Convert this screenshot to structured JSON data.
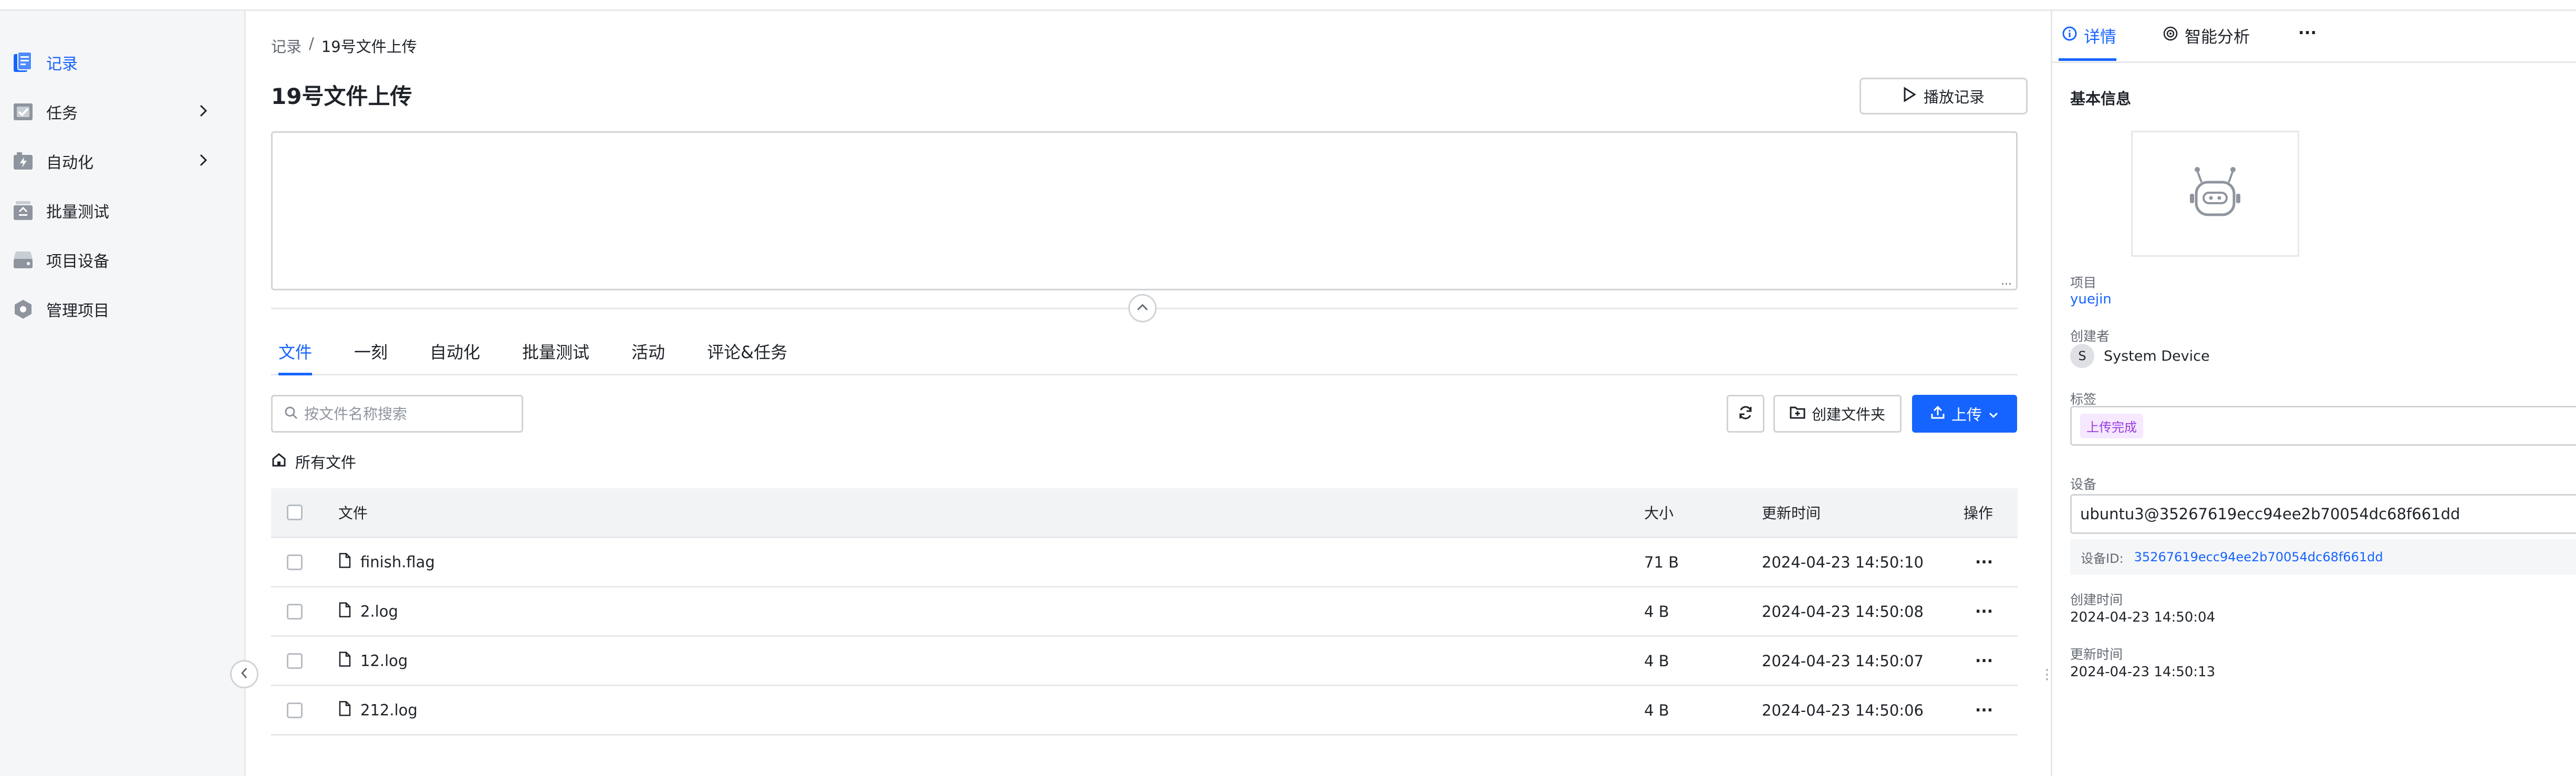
{
  "sidebar": {
    "items": [
      {
        "label": "记录",
        "icon": "record-icon",
        "active": true
      },
      {
        "label": "任务",
        "icon": "task-icon",
        "has_children": true
      },
      {
        "label": "自动化",
        "icon": "automation-icon",
        "has_children": true
      },
      {
        "label": "批量测试",
        "icon": "batch-test-icon"
      },
      {
        "label": "项目设备",
        "icon": "device-icon"
      },
      {
        "label": "管理项目",
        "icon": "manage-project-icon"
      }
    ]
  },
  "breadcrumb": {
    "root": "记录",
    "separator": "/",
    "current": "19号文件上传"
  },
  "page": {
    "title": "19号文件上传",
    "play_button": "播放记录",
    "textarea_resize": "..."
  },
  "tabs": [
    "文件",
    "一刻",
    "自动化",
    "批量测试",
    "活动",
    "评论&任务"
  ],
  "files": {
    "search_placeholder": "按文件名称搜索",
    "new_folder_button": "创建文件夹",
    "upload_button": "上传",
    "all_files_label": "所有文件",
    "columns": {
      "name": "文件",
      "size": "大小",
      "updated": "更新时间",
      "actions": "操作"
    },
    "rows": [
      {
        "name": "finish.flag",
        "size": "71 B",
        "updated": "2024-04-23 14:50:10",
        "actions": "···"
      },
      {
        "name": "2.log",
        "size": "4 B",
        "updated": "2024-04-23 14:50:08",
        "actions": "···"
      },
      {
        "name": "12.log",
        "size": "4 B",
        "updated": "2024-04-23 14:50:07",
        "actions": "···"
      },
      {
        "name": "212.log",
        "size": "4 B",
        "updated": "2024-04-23 14:50:06",
        "actions": "···"
      }
    ]
  },
  "right_panel": {
    "tabs": {
      "details": "详情",
      "analysis": "智能分析",
      "more": "···"
    },
    "section_title": "基本信息",
    "project_label": "项目",
    "project_value": "yuejin",
    "creator_label": "创建者",
    "creator_initial": "S",
    "creator_name": "System Device",
    "tag_label": "标签",
    "tag_value": "上传完成",
    "device_label": "设备",
    "device_value": "ubuntu3@35267619ecc94ee2b70054dc68f661dd",
    "device_id_label": "设备ID:",
    "device_id_value": "35267619ecc94ee2b70054dc68f661dd",
    "created_label": "创建时间",
    "created_value": "2024-04-23 14:50:04",
    "updated_label": "更新时间",
    "updated_value": "2024-04-23 14:50:13"
  },
  "colors": {
    "accent": "#1664ff",
    "tag_bg": "#f5e8ff",
    "tag_text": "#9a3ae0"
  }
}
